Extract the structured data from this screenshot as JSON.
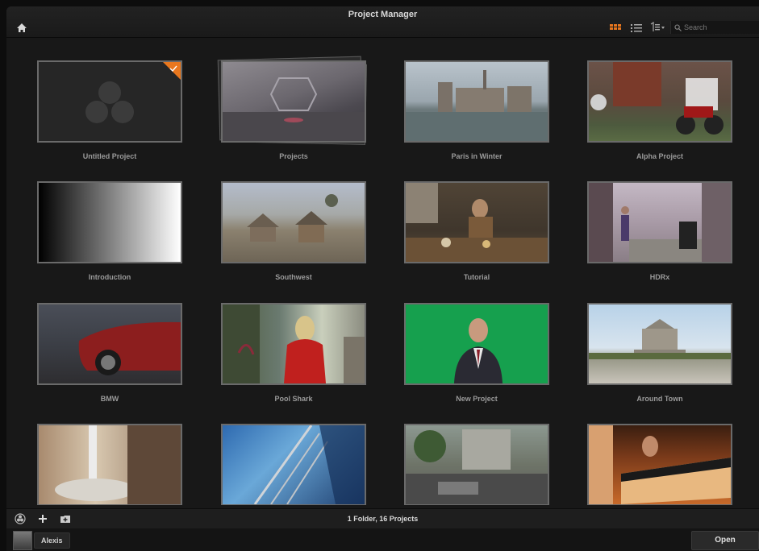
{
  "window": {
    "title": "Project Manager"
  },
  "toolbar": {
    "search_placeholder": "Search",
    "active_view": "grid"
  },
  "projects": [
    {
      "name": "Untitled Project",
      "thumb": "resolve-logo",
      "badge": "checkmark"
    },
    {
      "name": "Projects",
      "thumb": "folder-stack"
    },
    {
      "name": "Paris in Winter",
      "thumb": "cathedral-river"
    },
    {
      "name": "Alpha Project",
      "thumb": "motorcycle-cafe"
    },
    {
      "name": "Introduction",
      "thumb": "gradient-ramp"
    },
    {
      "name": "Southwest",
      "thumb": "desert-village"
    },
    {
      "name": "Tutorial",
      "thumb": "cafe-interior"
    },
    {
      "name": "HDRx",
      "thumb": "green-screen-set"
    },
    {
      "name": "BMW",
      "thumb": "red-car"
    },
    {
      "name": "Pool Shark",
      "thumb": "woman-red-jacket"
    },
    {
      "name": "New Project",
      "thumb": "presenter-greenscreen"
    },
    {
      "name": "Around Town",
      "thumb": "shrine-monument"
    },
    {
      "name": "",
      "thumb": "waterfall-rock"
    },
    {
      "name": "",
      "thumb": "glass-building"
    },
    {
      "name": "",
      "thumb": "city-street"
    },
    {
      "name": "",
      "thumb": "pianist"
    }
  ],
  "status": {
    "text": "1 Folder, 16 Projects"
  },
  "user": {
    "name": "Alexis"
  },
  "actions": {
    "open_label": "Open"
  },
  "colors": {
    "accent": "#e8771e",
    "background": "#181818"
  }
}
